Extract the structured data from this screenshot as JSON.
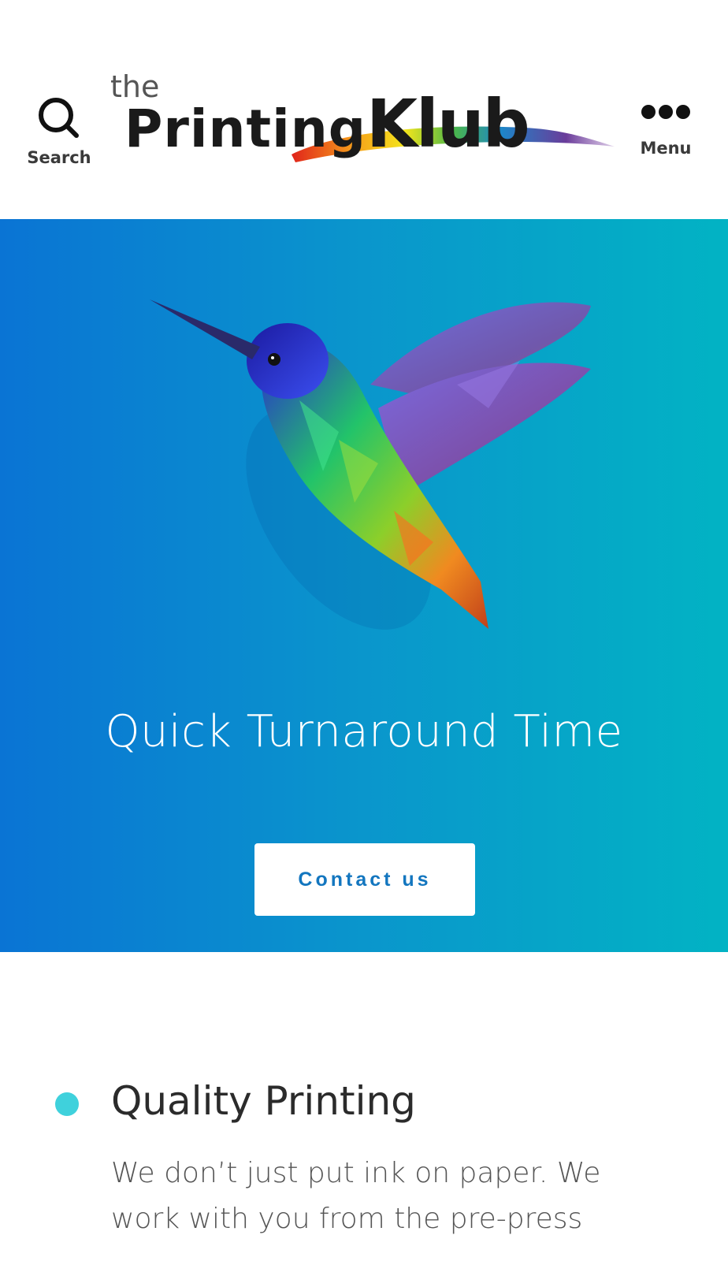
{
  "header": {
    "search_label": "Search",
    "menu_label": "Menu",
    "logo": {
      "small": "the",
      "word1": "Printing",
      "word2": "Klub"
    }
  },
  "hero": {
    "title": "Quick Turnaround Time",
    "cta_label": "Contact us",
    "gradient": [
      "#0a74d4",
      "#02b3c4"
    ]
  },
  "feature": {
    "title": "Quality Printing",
    "text": "We don’t just put ink on paper. We work with you from the pre-press",
    "accent": "#3fd1dc"
  }
}
